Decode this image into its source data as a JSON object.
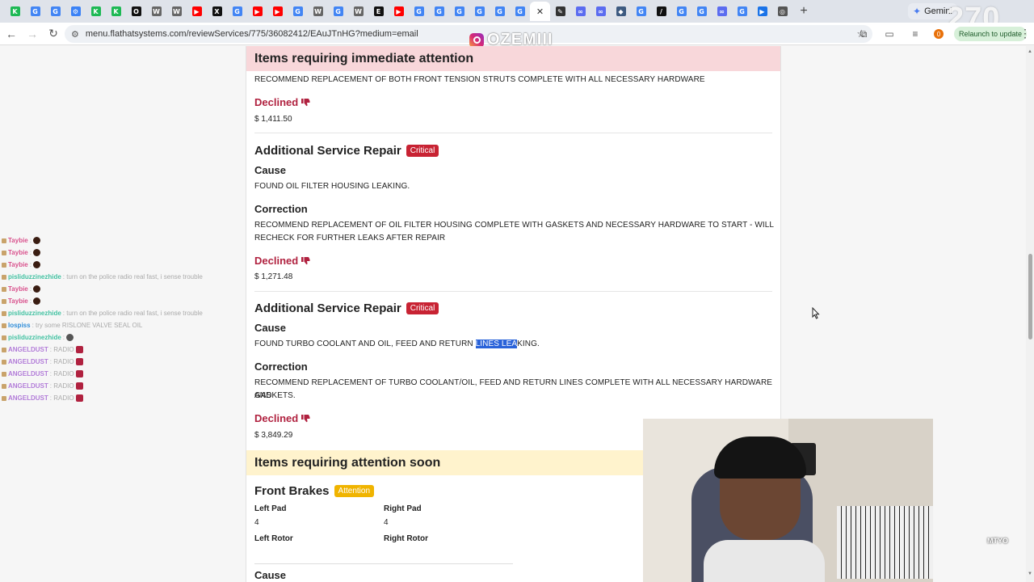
{
  "browser": {
    "tabs": [
      {
        "icon": "k-green-icon",
        "color": "#1db954",
        "glyph": "K"
      },
      {
        "icon": "google-icon",
        "color": "#4285f4",
        "glyph": "G"
      },
      {
        "icon": "google-icon",
        "color": "#4285f4",
        "glyph": "G"
      },
      {
        "icon": "settings-icon",
        "color": "#3b82f6",
        "glyph": "⚙"
      },
      {
        "icon": "k-green-icon",
        "color": "#1db954",
        "glyph": "K"
      },
      {
        "icon": "k-green-icon",
        "color": "#1db954",
        "glyph": "K"
      },
      {
        "icon": "black-circle-icon",
        "color": "#111111",
        "glyph": "O"
      },
      {
        "icon": "wikipedia-icon",
        "color": "#666666",
        "glyph": "W"
      },
      {
        "icon": "wikipedia-icon",
        "color": "#666666",
        "glyph": "W"
      },
      {
        "icon": "youtube-icon",
        "color": "#ff0000",
        "glyph": "▶"
      },
      {
        "icon": "x-icon",
        "color": "#111111",
        "glyph": "X"
      },
      {
        "icon": "google-icon",
        "color": "#4285f4",
        "glyph": "G"
      },
      {
        "icon": "youtube-icon",
        "color": "#ff0000",
        "glyph": "▶"
      },
      {
        "icon": "youtube-icon",
        "color": "#ff0000",
        "glyph": "▶"
      },
      {
        "icon": "google-icon",
        "color": "#4285f4",
        "glyph": "G"
      },
      {
        "icon": "wikipedia-icon",
        "color": "#666666",
        "glyph": "W"
      },
      {
        "icon": "google-icon",
        "color": "#4285f4",
        "glyph": "G"
      },
      {
        "icon": "wikipedia-icon",
        "color": "#666666",
        "glyph": "W"
      },
      {
        "icon": "news-icon",
        "color": "#111111",
        "glyph": "E"
      },
      {
        "icon": "youtube-icon",
        "color": "#ff0000",
        "glyph": "▶"
      },
      {
        "icon": "google-icon",
        "color": "#4285f4",
        "glyph": "G"
      },
      {
        "icon": "google-icon",
        "color": "#4285f4",
        "glyph": "G"
      },
      {
        "icon": "google-icon",
        "color": "#4285f4",
        "glyph": "G"
      },
      {
        "icon": "google-icon",
        "color": "#4285f4",
        "glyph": "G"
      },
      {
        "icon": "google-icon",
        "color": "#4285f4",
        "glyph": "G"
      },
      {
        "icon": "google-icon",
        "color": "#4285f4",
        "glyph": "G"
      },
      {
        "icon": "close-icon",
        "color": "#333333",
        "glyph": "✕",
        "active": true
      },
      {
        "icon": "pen-icon",
        "color": "#333333",
        "glyph": "✎"
      },
      {
        "icon": "link-icon",
        "color": "#5b6cf0",
        "glyph": "∞"
      },
      {
        "icon": "link-icon",
        "color": "#5b6cf0",
        "glyph": "∞"
      },
      {
        "icon": "android-icon",
        "color": "#3d5a80",
        "glyph": "◆"
      },
      {
        "icon": "google-icon",
        "color": "#4285f4",
        "glyph": "G"
      },
      {
        "icon": "slash-icon",
        "color": "#111111",
        "glyph": "/"
      },
      {
        "icon": "google-icon",
        "color": "#4285f4",
        "glyph": "G"
      },
      {
        "icon": "google-icon",
        "color": "#4285f4",
        "glyph": "G"
      },
      {
        "icon": "link-icon",
        "color": "#5b6cf0",
        "glyph": "∞"
      },
      {
        "icon": "google-icon",
        "color": "#4285f4",
        "glyph": "G"
      },
      {
        "icon": "play-icon",
        "color": "#1a73e8",
        "glyph": "▶"
      },
      {
        "icon": "chrome-icon",
        "color": "#555555",
        "glyph": "◎"
      }
    ],
    "gemini_tab": "Gemini",
    "overlay_count": "270",
    "url": "menu.flathatsystems.com/reviewServices/775/36082412/EAuJTnHG?medium=email",
    "relaunch_label": "Relaunch to update",
    "extension_badge": "0",
    "instagram_handle": "OZEMIII"
  },
  "page": {
    "immediate_title": "Items requiring immediate attention",
    "top_item": {
      "correction": "RECOMMEND REPLACEMENT OF BOTH FRONT TENSION STRUTS COMPLETE WITH ALL NECESSARY HARDWARE",
      "status": "Declined",
      "price": "$ 1,411.50"
    },
    "repairs": [
      {
        "title": "Additional Service Repair",
        "badge": "Critical",
        "cause_label": "Cause",
        "cause": "FOUND OIL FILTER HOUSING LEAKING.",
        "correction_label": "Correction",
        "correction_line1": "RECOMMEND REPLACEMENT OF OIL FILTER HOUSING COMPLETE WITH GASKETS AND NECESSARY HARDWARE TO START - WILL",
        "correction_line2": "RECHECK FOR FURTHER LEAKS AFTER REPAIR",
        "status": "Declined",
        "price": "$ 1,271.48"
      },
      {
        "title": "Additional Service Repair",
        "badge": "Critical",
        "cause_label": "Cause",
        "cause_before": "FOUND TURBO COOLANT AND OIL, FEED AND RETURN ",
        "cause_selected": "LINES LEA",
        "cause_after": "KING.",
        "correction_label": "Correction",
        "correction_line1": "RECOMMEND REPLACEMENT OF TURBO COOLANT/OIL, FEED AND RETURN LINES COMPLETE WITH ALL NECESSARY HARDWARE AND",
        "correction_line2": "GASKETS.",
        "status": "Declined",
        "price": "$ 3,849.29"
      }
    ],
    "soon_title": "Items requiring attention soon",
    "brakes": {
      "title": "Front Brakes",
      "badge": "Attention",
      "left_pad_label": "Left Pad",
      "left_pad_value": "4",
      "right_pad_label": "Right Pad",
      "right_pad_value": "4",
      "left_rotor_label": "Left Rotor",
      "right_rotor_label": "Right Rotor",
      "cause_label": "Cause"
    }
  },
  "chat": [
    {
      "user": "Taybie",
      "msg": ":",
      "color": "#d64f8a",
      "emote": "dark"
    },
    {
      "user": "Taybie",
      "msg": ":",
      "color": "#d64f8a",
      "emote": "dark"
    },
    {
      "user": "Taybie",
      "msg": ":",
      "color": "#d64f8a",
      "emote": "dark"
    },
    {
      "user": "pisliduzzinezhide",
      "msg": ": turn on the police radio real fast, i sense trouble",
      "color": "#3fbf9f",
      "emote": ""
    },
    {
      "user": "Taybie",
      "msg": ":",
      "color": "#d64f8a",
      "emote": "dark"
    },
    {
      "user": "Taybie",
      "msg": ":",
      "color": "#d64f8a",
      "emote": "dark"
    },
    {
      "user": "pisliduzzinezhide",
      "msg": ": turn on the police radio real fast, i sense trouble",
      "color": "#3fbf9f",
      "emote": ""
    },
    {
      "user": "lospiss",
      "msg": ": try some RISLONE VALVE SEAL OIL",
      "color": "#2e8bd6",
      "emote": ""
    },
    {
      "user": "pisliduzzinezhide",
      "msg": ":",
      "color": "#3fbf9f",
      "emote": "grey"
    },
    {
      "user": "ANGELDUST",
      "msg": ": RADIO",
      "color": "#b07ad6",
      "emote": "red"
    },
    {
      "user": "ANGELDUST",
      "msg": ": RADIO",
      "color": "#b07ad6",
      "emote": "red"
    },
    {
      "user": "ANGELDUST",
      "msg": ": RADIO",
      "color": "#b07ad6",
      "emote": "red"
    },
    {
      "user": "ANGELDUST",
      "msg": ": RADIO",
      "color": "#b07ad6",
      "emote": "red"
    },
    {
      "user": "ANGELDUST",
      "msg": ": RADIO",
      "color": "#b07ad6",
      "emote": "red"
    }
  ],
  "webcam": {
    "watermark": "MTYO"
  },
  "scrollbar": {
    "position_fraction": 0.46
  },
  "colors": {
    "declined": "#b0213f",
    "critical": "#c82333",
    "attention": "#f0b400",
    "immediate_header_bg": "#f8d7da",
    "soon_header_bg": "#fff3cd",
    "selection": "#2962d9"
  }
}
